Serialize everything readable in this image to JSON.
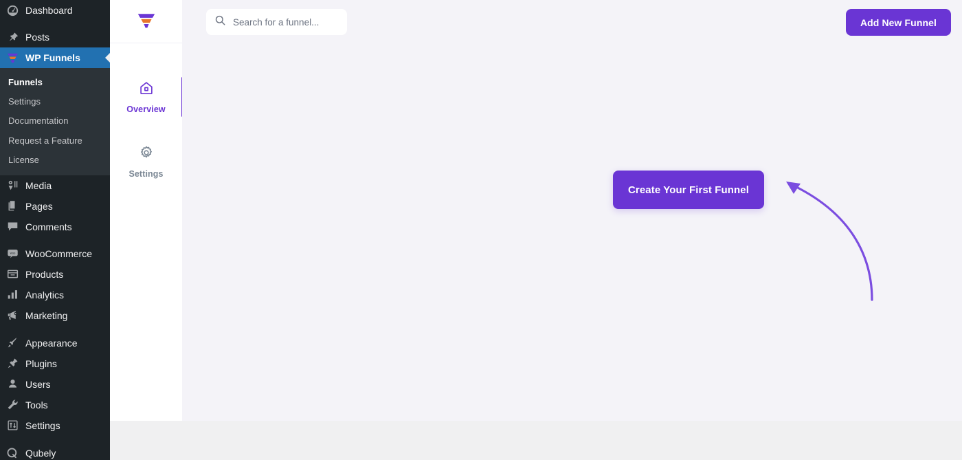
{
  "wp_sidebar": {
    "items": [
      {
        "label": "Dashboard",
        "icon": "dashboard-gauge-icon",
        "active": false
      },
      {
        "label": "Posts",
        "icon": "pushpin-icon",
        "active": false
      },
      {
        "label": "WP Funnels",
        "icon": "funnel-icon",
        "active": true
      },
      {
        "label": "Media",
        "icon": "media-icon",
        "active": false
      },
      {
        "label": "Pages",
        "icon": "pages-icon",
        "active": false
      },
      {
        "label": "Comments",
        "icon": "comments-icon",
        "active": false
      },
      {
        "label": "WooCommerce",
        "icon": "woocommerce-icon",
        "active": false
      },
      {
        "label": "Products",
        "icon": "products-icon",
        "active": false
      },
      {
        "label": "Analytics",
        "icon": "analytics-bars-icon",
        "active": false
      },
      {
        "label": "Marketing",
        "icon": "megaphone-icon",
        "active": false
      },
      {
        "label": "Appearance",
        "icon": "paintbrush-icon",
        "active": false
      },
      {
        "label": "Plugins",
        "icon": "plug-icon",
        "active": false
      },
      {
        "label": "Users",
        "icon": "user-icon",
        "active": false
      },
      {
        "label": "Tools",
        "icon": "wrench-icon",
        "active": false
      },
      {
        "label": "Settings",
        "icon": "settings-sliders-icon",
        "active": false
      },
      {
        "label": "Qubely",
        "icon": "qubely-q-icon",
        "active": false
      }
    ],
    "submenu": [
      {
        "label": "Funnels",
        "current": true
      },
      {
        "label": "Settings",
        "current": false
      },
      {
        "label": "Documentation",
        "current": false
      },
      {
        "label": "Request a Feature",
        "current": false
      },
      {
        "label": "License",
        "current": false
      }
    ]
  },
  "app": {
    "brand_icon": "wp-funnels-logo-icon",
    "nav": [
      {
        "label": "Overview",
        "icon": "home-icon",
        "active": true
      },
      {
        "label": "Settings",
        "icon": "gear-icon",
        "active": false
      }
    ],
    "search": {
      "placeholder": "Search for a funnel...",
      "value": "",
      "icon": "search-icon"
    },
    "add_funnel_label": "Add New Funnel",
    "empty_state": {
      "cta_label": "Create Your First Funnel",
      "arrow_icon": "curved-arrow-icon"
    }
  },
  "colors": {
    "accent_purple": "#6a35d4",
    "wp_admin_bg": "#1d2327",
    "wp_submenu_bg": "#2c3338",
    "wp_active_blue": "#2271b1",
    "content_bg": "#f4f3f8",
    "footer_bg": "#f0f0f1",
    "logo_orange": "#e8762c"
  }
}
